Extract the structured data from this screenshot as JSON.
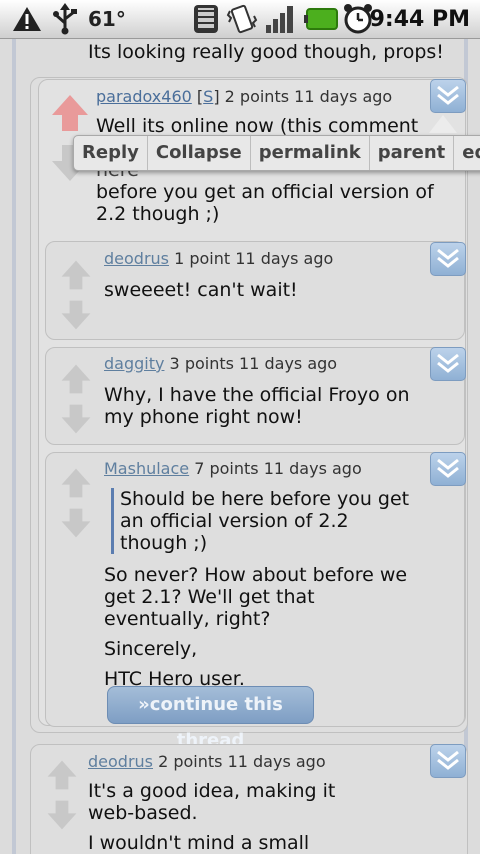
{
  "status_bar": {
    "temperature": "61°",
    "time": "9:44 PM",
    "icons": [
      "warning-icon",
      "usb-icon",
      "wifi-icon",
      "vibrate-icon",
      "signal-icon",
      "battery-icon",
      "alarm-icon"
    ]
  },
  "top_text": "Its looking really good though, props!",
  "action_bar": {
    "reply": "Reply",
    "collapse": "Collapse",
    "permalink": "permalink",
    "parent": "parent",
    "edit": "edit"
  },
  "comments": [
    {
      "author": "paradox460",
      "flair": "[S]",
      "flair_letter": "S",
      "meta": " 2 points 11 days ago",
      "lines": [
        "Well its online now (this comment",
        "password protected. Should be here",
        "before you get an official version of",
        "2.2 though ;)"
      ]
    },
    {
      "author": "deodrus",
      "meta": " 1 point 11 days ago",
      "text": "sweeeet! can't wait!"
    },
    {
      "author": "daggity",
      "meta": " 3 points 11 days ago",
      "text": "Why, I have the official Froyo on my phone right now!"
    },
    {
      "author": "Mashulace",
      "meta": " 7 points 11 days ago",
      "quote": "Should be here before you get an official version of 2.2 though ;)",
      "paragraphs": [
        "So never? How about before we get 2.1? We'll get that eventually, right?",
        "Sincerely,",
        "HTC Hero user."
      ],
      "continue_label": "»continue this thread"
    },
    {
      "author": "deodrus",
      "meta": " 2 points 11 days ago",
      "paragraphs": [
        "It's a good idea, making it web-based.",
        "I wouldn't mind a small widget to"
      ]
    }
  ]
}
